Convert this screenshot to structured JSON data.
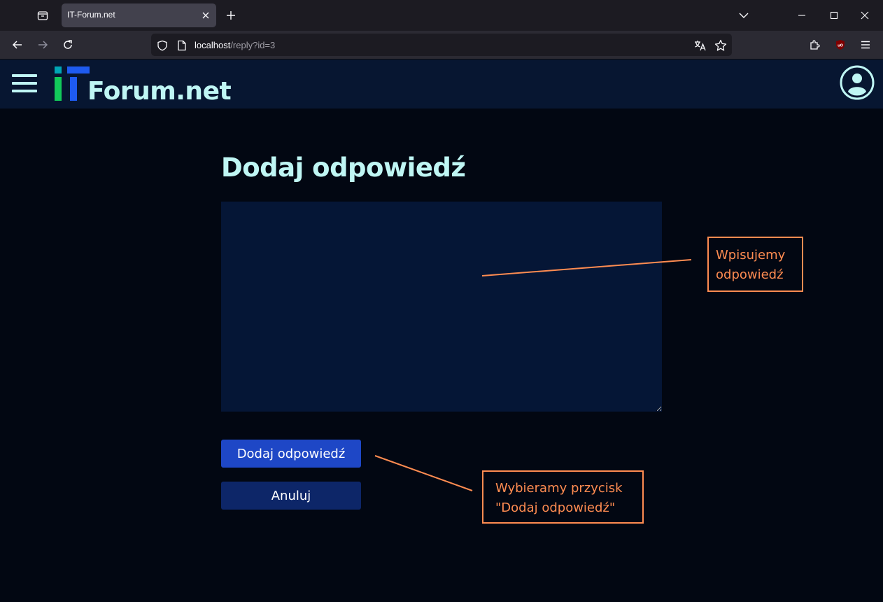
{
  "browser": {
    "tab_title": "IT-Forum.net",
    "url_host": "localhost",
    "url_path": "/reply?id=3"
  },
  "site": {
    "logo_text": "Forum.net"
  },
  "main": {
    "title": "Dodaj odpowiedź",
    "reply_textarea_value": "",
    "submit_label": "Dodaj odpowiedź",
    "cancel_label": "Anuluj"
  },
  "annotations": {
    "callout_1": [
      "Wpisujemy",
      "odpowiedź"
    ],
    "callout_2": [
      "Wybieramy przycisk",
      "\"Dodaj odpowiedź\""
    ],
    "color": "#ff8c51"
  },
  "colors": {
    "page_bg": "#020712",
    "header_bg": "#071631",
    "accent_text": "#bff6f4",
    "primary_button": "#1e47c6",
    "secondary_button": "#0d2668",
    "textarea_bg": "#051636"
  }
}
